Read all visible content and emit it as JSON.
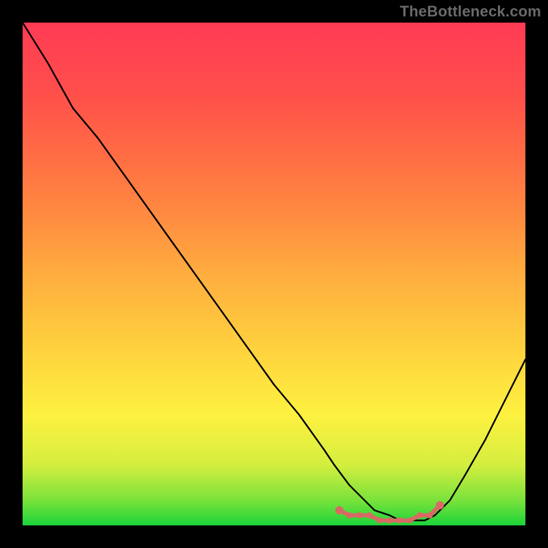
{
  "watermark": "TheBottleneck.com",
  "colors": {
    "frame": "#000000",
    "gradient_top": "#ff3b55",
    "gradient_bottom": "#1bd43a",
    "curve": "#000000",
    "marker": "#d86a64"
  },
  "chart_data": {
    "type": "line",
    "title": "",
    "xlabel": "",
    "ylabel": "",
    "xlim": [
      0,
      100
    ],
    "ylim": [
      0,
      100
    ],
    "x": [
      0,
      5,
      10,
      15,
      20,
      25,
      30,
      35,
      40,
      45,
      50,
      55,
      60,
      62,
      65,
      68,
      70,
      73,
      75,
      78,
      80,
      82,
      85,
      88,
      92,
      96,
      100
    ],
    "y": [
      100,
      92,
      83,
      77,
      70,
      63,
      56,
      49,
      42,
      35,
      28,
      22,
      15,
      12,
      8,
      5,
      3,
      2,
      1,
      1,
      1,
      2,
      5,
      10,
      17,
      25,
      33
    ],
    "highlight_points": {
      "x": [
        63,
        65,
        67,
        69,
        71,
        73,
        75,
        77,
        79,
        81,
        83
      ],
      "y": [
        3,
        2,
        2,
        2,
        1,
        1,
        1,
        1,
        2,
        2,
        4
      ]
    }
  }
}
